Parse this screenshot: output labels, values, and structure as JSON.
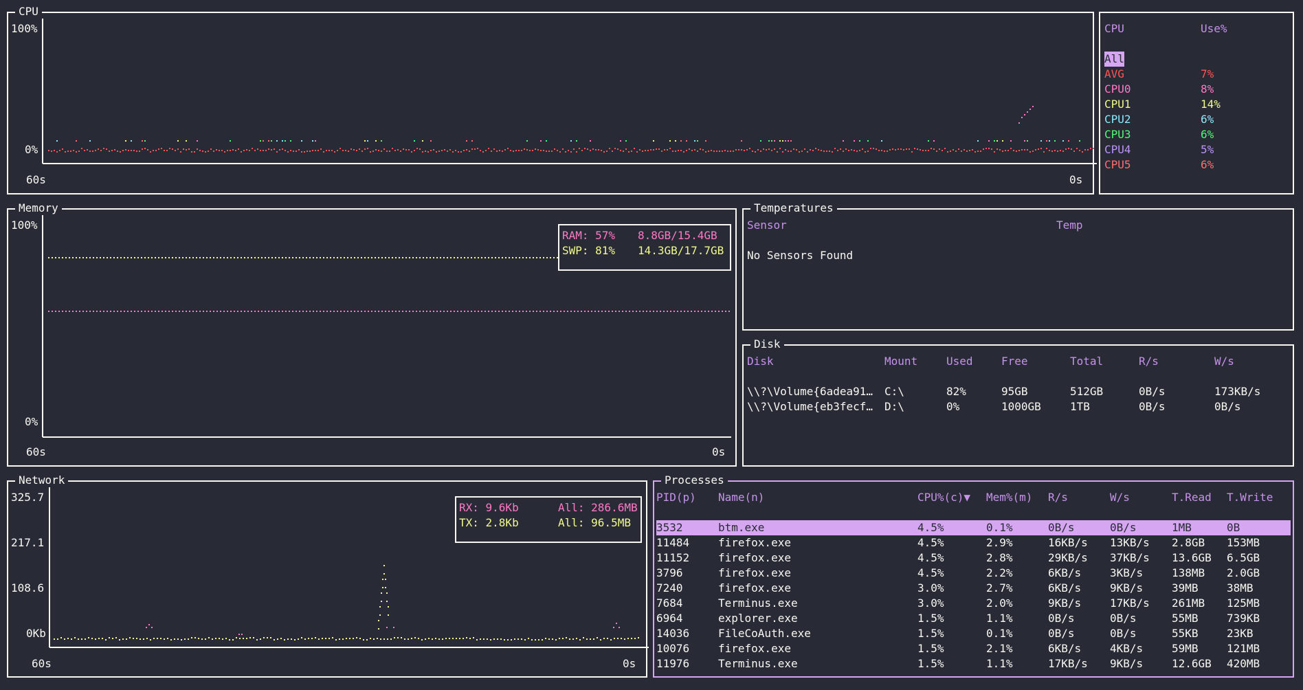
{
  "colors": {
    "bg": "#282a36",
    "fg": "#f8f8f2",
    "header": "#c792ea",
    "avg": "#ff5555",
    "cpu0": "#ff79c6",
    "cpu1": "#f1fa8c",
    "cpu2": "#8be9fd",
    "cpu3": "#50fa7b",
    "cpu4": "#bd93f9",
    "cpu5": "#ff6e6e",
    "ram": "#ff79c6",
    "swap": "#f1fa8c",
    "rx": "#ff79c6",
    "tx": "#f1fa8c",
    "selected_row": "#d6a6f2"
  },
  "cpu": {
    "title": "CPU",
    "y_top": "100%",
    "y_bottom": "0%",
    "x_left": "60s",
    "x_right": "0s",
    "legend_header": {
      "cpu": "CPU",
      "use": "Use%"
    },
    "selected": "All",
    "rows": [
      {
        "name": "AVG",
        "use": "7%",
        "color": "#ff5555"
      },
      {
        "name": "CPU0",
        "use": "8%",
        "color": "#ff79c6"
      },
      {
        "name": "CPU1",
        "use": "14%",
        "color": "#f1fa8c"
      },
      {
        "name": "CPU2",
        "use": "6%",
        "color": "#8be9fd"
      },
      {
        "name": "CPU3",
        "use": "6%",
        "color": "#50fa7b"
      },
      {
        "name": "CPU4",
        "use": "5%",
        "color": "#bd93f9"
      },
      {
        "name": "CPU5",
        "use": "6%",
        "color": "#ff6e6e"
      }
    ]
  },
  "memory": {
    "title": "Memory",
    "y_top": "100%",
    "y_bottom": "0%",
    "x_left": "60s",
    "x_right": "0s",
    "ram_label": "RAM: 57%",
    "ram_value": "8.8GB/15.4GB",
    "ram_pct": 57,
    "swp_label": "SWP: 81%",
    "swp_value": "14.3GB/17.7GB",
    "swp_pct": 81
  },
  "temperatures": {
    "title": "Temperatures",
    "col_sensor": "Sensor",
    "col_temp": "Temp",
    "message": "No Sensors Found"
  },
  "disk": {
    "title": "Disk",
    "columns": [
      "Disk",
      "Mount",
      "Used",
      "Free",
      "Total",
      "R/s",
      "W/s"
    ],
    "rows": [
      [
        "\\\\?\\Volume{6adea91…",
        "C:\\",
        "82%",
        "95GB",
        "512GB",
        "0B/s",
        "173KB/s"
      ],
      [
        "\\\\?\\Volume{eb3fecf…",
        "D:\\",
        "0%",
        "1000GB",
        "1TB",
        "0B/s",
        "0B/s"
      ]
    ]
  },
  "network": {
    "title": "Network",
    "y_ticks": [
      "325.7",
      "217.1",
      "108.6",
      "0Kb"
    ],
    "x_left": "60s",
    "x_right": "0s",
    "rx_label": "RX: 9.6Kb",
    "rx_all": "All: 286.6MB",
    "tx_label": "TX: 2.8Kb",
    "tx_all": "All: 96.5MB"
  },
  "processes": {
    "title": "Processes",
    "columns": [
      "PID(p)",
      "Name(n)",
      "CPU%(c)▼",
      "Mem%(m)",
      "R/s",
      "W/s",
      "T.Read",
      "T.Write"
    ],
    "rows": [
      [
        "3532",
        "btm.exe",
        "4.5%",
        "0.1%",
        "0B/s",
        "0B/s",
        "1MB",
        "0B"
      ],
      [
        "11484",
        "firefox.exe",
        "4.5%",
        "2.9%",
        "16KB/s",
        "13KB/s",
        "2.8GB",
        "153MB"
      ],
      [
        "11152",
        "firefox.exe",
        "4.5%",
        "2.8%",
        "29KB/s",
        "37KB/s",
        "13.6GB",
        "6.5GB"
      ],
      [
        "3796",
        "firefox.exe",
        "4.5%",
        "2.2%",
        "6KB/s",
        "3KB/s",
        "138MB",
        "2.0GB"
      ],
      [
        "7240",
        "firefox.exe",
        "3.0%",
        "2.7%",
        "6KB/s",
        "9KB/s",
        "39MB",
        "38MB"
      ],
      [
        "7684",
        "Terminus.exe",
        "3.0%",
        "2.0%",
        "9KB/s",
        "17KB/s",
        "261MB",
        "125MB"
      ],
      [
        "6964",
        "explorer.exe",
        "1.5%",
        "1.1%",
        "0B/s",
        "0B/s",
        "55MB",
        "739KB"
      ],
      [
        "14036",
        "FileCoAuth.exe",
        "1.5%",
        "0.1%",
        "0B/s",
        "0B/s",
        "55KB",
        "23KB"
      ],
      [
        "10076",
        "firefox.exe",
        "1.5%",
        "2.1%",
        "6KB/s",
        "4KB/s",
        "59MB",
        "121MB"
      ],
      [
        "11976",
        "Terminus.exe",
        "1.5%",
        "1.1%",
        "17KB/s",
        "9KB/s",
        "12.6GB",
        "420MB"
      ]
    ]
  }
}
